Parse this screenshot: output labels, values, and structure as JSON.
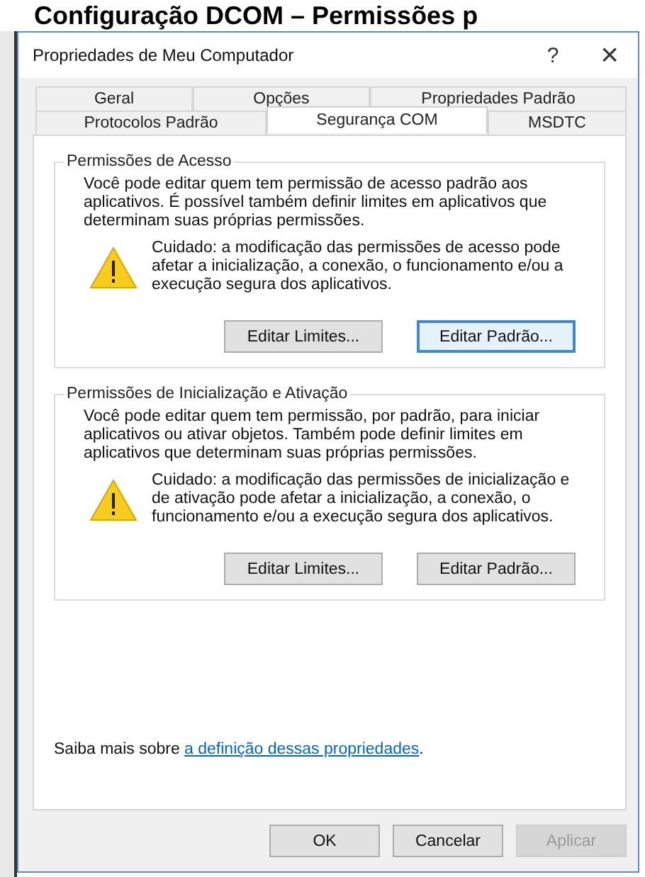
{
  "heading": "Configuração DCOM – Permissões p",
  "window": {
    "title": "Propriedades de Meu Computador",
    "help": "?",
    "close": "×"
  },
  "tab_rows": [
    [
      {
        "label": "Geral",
        "selected": false
      },
      {
        "label": "Opções",
        "selected": false
      },
      {
        "label": "Propriedades Padrão",
        "selected": false
      }
    ],
    [
      {
        "label": "Protocolos Padrão",
        "selected": false
      },
      {
        "label": "Segurança COM",
        "selected": true
      },
      {
        "label": "MSDTC",
        "selected": false
      }
    ]
  ],
  "groups": [
    {
      "title": "Permissões de Acesso",
      "description": "Você pode editar quem tem permissão de acesso padrão aos aplicativos. É possível também definir limites em aplicativos que determinam suas próprias permissões.",
      "warning": "Cuidado: a modificação das permissões de acesso pode afetar a inicialização, a conexão, o funcionamento e/ou a execução segura dos aplicativos.",
      "buttons": [
        {
          "label": "Editar Limites...",
          "focused": false
        },
        {
          "label": "Editar Padrão...",
          "focused": true
        }
      ]
    },
    {
      "title": "Permissões de Inicialização e Ativação",
      "description": "Você pode editar quem tem permissão, por padrão, para iniciar aplicativos ou ativar objetos. Também pode definir limites em aplicativos que determinam suas próprias permissões.",
      "warning": "Cuidado: a modificação das permissões de inicialização e de ativação pode afetar a inicialização, a conexão, o funcionamento e/ou a execução segura dos aplicativos.",
      "buttons": [
        {
          "label": "Editar Limites...",
          "focused": false
        },
        {
          "label": "Editar Padrão...",
          "focused": false
        }
      ]
    }
  ],
  "footer": {
    "text": "Saiba mais sobre",
    "link": "a definição dessas propriedades",
    "after": "."
  },
  "buttons": [
    {
      "label": "OK",
      "disabled": false
    },
    {
      "label": "Cancelar",
      "disabled": false
    },
    {
      "label": "Aplicar",
      "disabled": true
    }
  ]
}
